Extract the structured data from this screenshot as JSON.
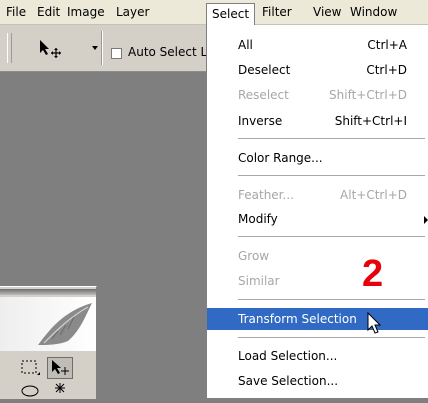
{
  "menubar": {
    "items": [
      "File",
      "Edit",
      "Image",
      "Layer",
      "Select",
      "Filter",
      "View",
      "Window"
    ]
  },
  "options_bar": {
    "tool_icon": "move-tool-icon",
    "auto_select_label": "Auto Select L"
  },
  "select_menu": {
    "items": [
      {
        "label": "All",
        "shortcut": "Ctrl+A",
        "enabled": true
      },
      {
        "label": "Deselect",
        "shortcut": "Ctrl+D",
        "enabled": true
      },
      {
        "label": "Reselect",
        "shortcut": "Shift+Ctrl+D",
        "enabled": false
      },
      {
        "label": "Inverse",
        "shortcut": "Shift+Ctrl+I",
        "enabled": true
      },
      {
        "label": "Color Range...",
        "shortcut": "",
        "enabled": true
      },
      {
        "label": "Feather...",
        "shortcut": "Alt+Ctrl+D",
        "enabled": false
      },
      {
        "label": "Modify",
        "shortcut": "",
        "enabled": true,
        "submenu": true
      },
      {
        "label": "Grow",
        "shortcut": "",
        "enabled": false
      },
      {
        "label": "Similar",
        "shortcut": "",
        "enabled": false
      },
      {
        "label": "Transform Selection",
        "shortcut": "",
        "enabled": true,
        "highlighted": true
      },
      {
        "label": "Load Selection...",
        "shortcut": "",
        "enabled": true
      },
      {
        "label": "Save Selection...",
        "shortcut": "",
        "enabled": true
      }
    ]
  },
  "annotation": {
    "step_number": "2"
  },
  "tools_panel": {
    "icons": [
      "feather-logo-icon",
      "marquee-tool-icon",
      "move-tool-icon",
      "lasso-tool-icon",
      "magic-wand-tool-icon"
    ]
  },
  "colors": {
    "highlight": "#316ac5",
    "menubar": "#ece9d8",
    "workspace": "#7f7f7f",
    "annotation": "#e8000b",
    "disabled_text": "#a7a6aa"
  }
}
